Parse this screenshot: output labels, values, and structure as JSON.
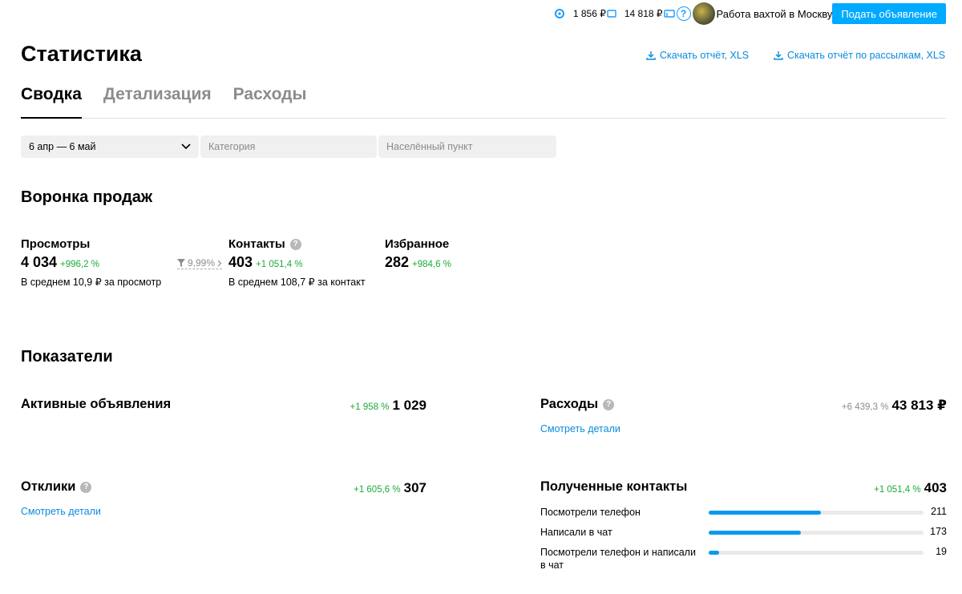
{
  "topbar": {
    "balance1": "1 856 ₽",
    "balance2": "14 818 ₽",
    "help": "?",
    "user_name": "Работа вахтой в Москву",
    "post_button": "Подать объявление"
  },
  "page": {
    "title": "Статистика",
    "download_report": "Скачать отчёт, XLS",
    "download_mailing_report": "Скачать отчёт по рассылкам, XLS"
  },
  "tabs": [
    {
      "label": "Сводка",
      "active": true
    },
    {
      "label": "Детализация",
      "active": false
    },
    {
      "label": "Расходы",
      "active": false
    }
  ],
  "filters": {
    "period": "6 апр — 6 май",
    "category_placeholder": "Категория",
    "city_placeholder": "Населённый пункт"
  },
  "funnel": {
    "title": "Воронка продаж",
    "views": {
      "label": "Просмотры",
      "value": "4 034",
      "change": "+996,2 %",
      "avg": "В среднем 10,9 ₽ за просмотр"
    },
    "conversion": "9,99%",
    "contacts": {
      "label": "Контакты",
      "value": "403",
      "change": "+1 051,4 %",
      "avg": "В среднем 108,7 ₽ за контакт"
    },
    "favorites": {
      "label": "Избранное",
      "value": "282",
      "change": "+984,6 %"
    }
  },
  "indicators": {
    "title": "Показатели",
    "active_ads": {
      "label": "Активные объявления",
      "change": "+1 958 %",
      "value": "1 029"
    },
    "expenses": {
      "label": "Расходы",
      "change": "+6 439,3 %",
      "value": "43 813 ₽",
      "details": "Смотреть детали"
    },
    "responses": {
      "label": "Отклики",
      "change": "+1 605,6 %",
      "value": "307",
      "details": "Смотреть детали"
    },
    "received_contacts": {
      "label": "Полученные контакты",
      "change": "+1 051,4 %",
      "value": "403",
      "rows": [
        {
          "label": "Посмотрели телефон",
          "value": "211",
          "share": 0.524
        },
        {
          "label": "Написали в чат",
          "value": "173",
          "share": 0.429
        },
        {
          "label": "Посмотрели телефон и написали в чат",
          "value": "19",
          "share": 0.047
        }
      ]
    }
  },
  "colors": {
    "accent": "#00aaff",
    "link": "#0a8ae0",
    "positive": "#1cab3a",
    "bar_fill": "#0a99f0"
  }
}
